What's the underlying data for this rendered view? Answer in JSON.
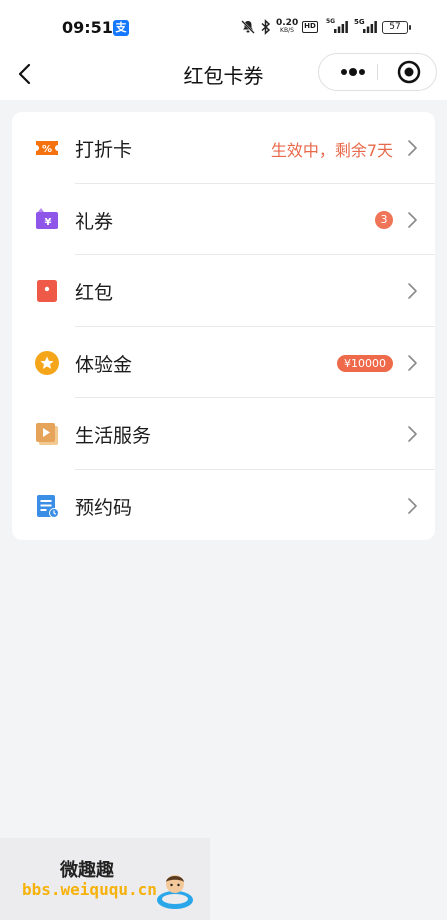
{
  "status_bar": {
    "time": "09:51",
    "app_icon": "alipay-icon",
    "network_speed": "0.20",
    "network_speed_unit": "KB/S",
    "hd_label": "HD",
    "signal_1": "5G",
    "signal_2": "5G",
    "battery": "57"
  },
  "nav": {
    "title": "红包卡券",
    "back_icon": "chevron-left-icon",
    "more_icon": "more-dots-icon",
    "close_icon": "target-close-icon"
  },
  "list": {
    "items": [
      {
        "label": "打折卡",
        "icon": "discount-card-icon",
        "icon_color": "#f5730f",
        "status": "生效中，剩余7天"
      },
      {
        "label": "礼券",
        "icon": "coupon-icon",
        "icon_color": "#8e55e8",
        "badge": "3"
      },
      {
        "label": "红包",
        "icon": "red-packet-icon",
        "icon_color": "#ef5a48"
      },
      {
        "label": "体验金",
        "icon": "experience-gold-icon",
        "icon_color": "#f4a51a",
        "amount": "¥10000"
      },
      {
        "label": "生活服务",
        "icon": "life-service-icon",
        "icon_color": "#e6a35a"
      },
      {
        "label": "预约码",
        "icon": "appointment-code-icon",
        "icon_color": "#3a8ee6"
      }
    ]
  },
  "watermark": {
    "title": "微趣趣",
    "url": "bbs.weiququ.cn"
  },
  "colors": {
    "accent": "#ef6a4a",
    "background": "#f3f4f6",
    "card": "#ffffff"
  }
}
